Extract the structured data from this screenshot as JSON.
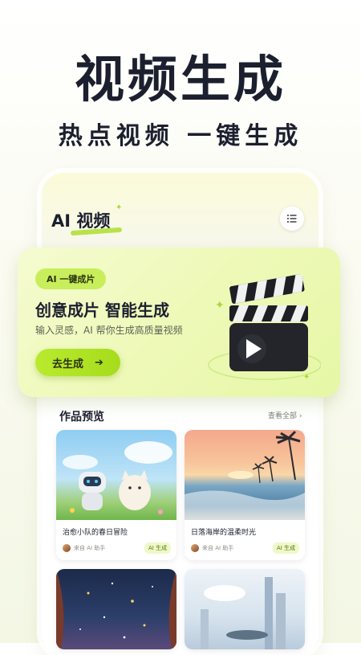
{
  "hero": {
    "headline": "视频生成",
    "subline": "热点视频 一键生成"
  },
  "app": {
    "title": "AI 视频",
    "menu_icon": "list-icon"
  },
  "banner": {
    "pill": "AI 一键成片",
    "title": "创意成片  智能生成",
    "subtitle": "输入灵感，AI 帮你生成高质量视频",
    "button_label": "去生成",
    "button_arrow": "➔",
    "illustration_icon": "clapperboard-play-icon"
  },
  "gallery": {
    "title": "作品预览",
    "see_all": "查看全部 ›",
    "items": [
      {
        "title": "治愈小队的春日冒险",
        "author": "来自 AI 助手",
        "tag": "AI 生成"
      },
      {
        "title": "日落海岸的温柔时光",
        "author": "来自 AI 助手",
        "tag": "AI 生成"
      }
    ]
  },
  "colors": {
    "accent": "#b9ea2e",
    "text": "#1b1f2e",
    "banner_bg": "#eef9b8"
  }
}
